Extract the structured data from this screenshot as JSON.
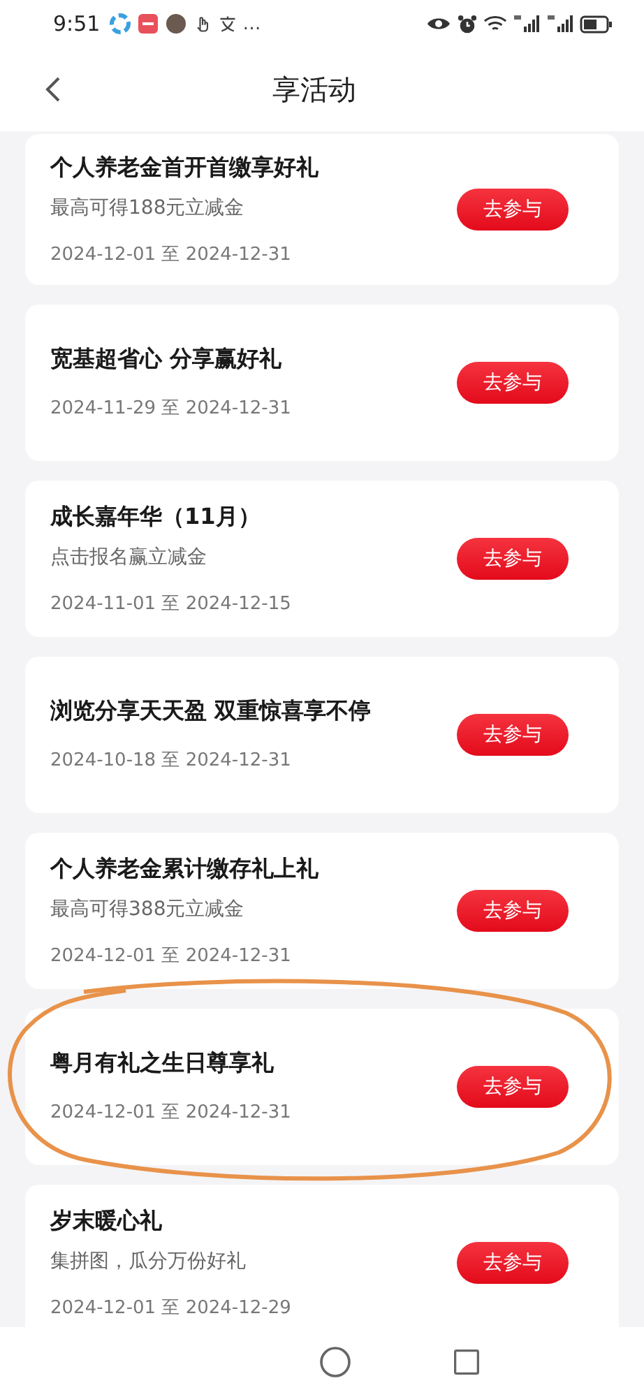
{
  "status_bar": {
    "time": "9:51",
    "overflow": "…"
  },
  "header": {
    "title": "享活动"
  },
  "activities": [
    {
      "title": "个人养老金首开首缴享好礼",
      "subtitle": "最高可得188元立减金",
      "dates": "2024-12-01 至 2024-12-31",
      "button": "去参与",
      "circled": false
    },
    {
      "title": "宽基超省心 分享赢好礼",
      "dates": "2024-11-29 至 2024-12-31",
      "button": "去参与",
      "circled": false
    },
    {
      "title": "成长嘉年华（11月）",
      "subtitle": "点击报名赢立减金",
      "dates": "2024-11-01 至 2024-12-15",
      "button": "去参与",
      "circled": false
    },
    {
      "title": "浏览分享天天盈 双重惊喜享不停",
      "dates": "2024-10-18 至 2024-12-31",
      "button": "去参与",
      "circled": false
    },
    {
      "title": "个人养老金累计缴存礼上礼",
      "subtitle": "最高可得388元立减金",
      "dates": "2024-12-01 至 2024-12-31",
      "button": "去参与",
      "circled": false
    },
    {
      "title": "粤月有礼之生日尊享礼",
      "dates": "2024-12-01 至 2024-12-31",
      "button": "去参与",
      "circled": true
    },
    {
      "title": "岁末暖心礼",
      "subtitle": "集拼图，瓜分万份好礼",
      "dates": "2024-12-01 至 2024-12-29",
      "button": "去参与",
      "circled": false
    }
  ]
}
